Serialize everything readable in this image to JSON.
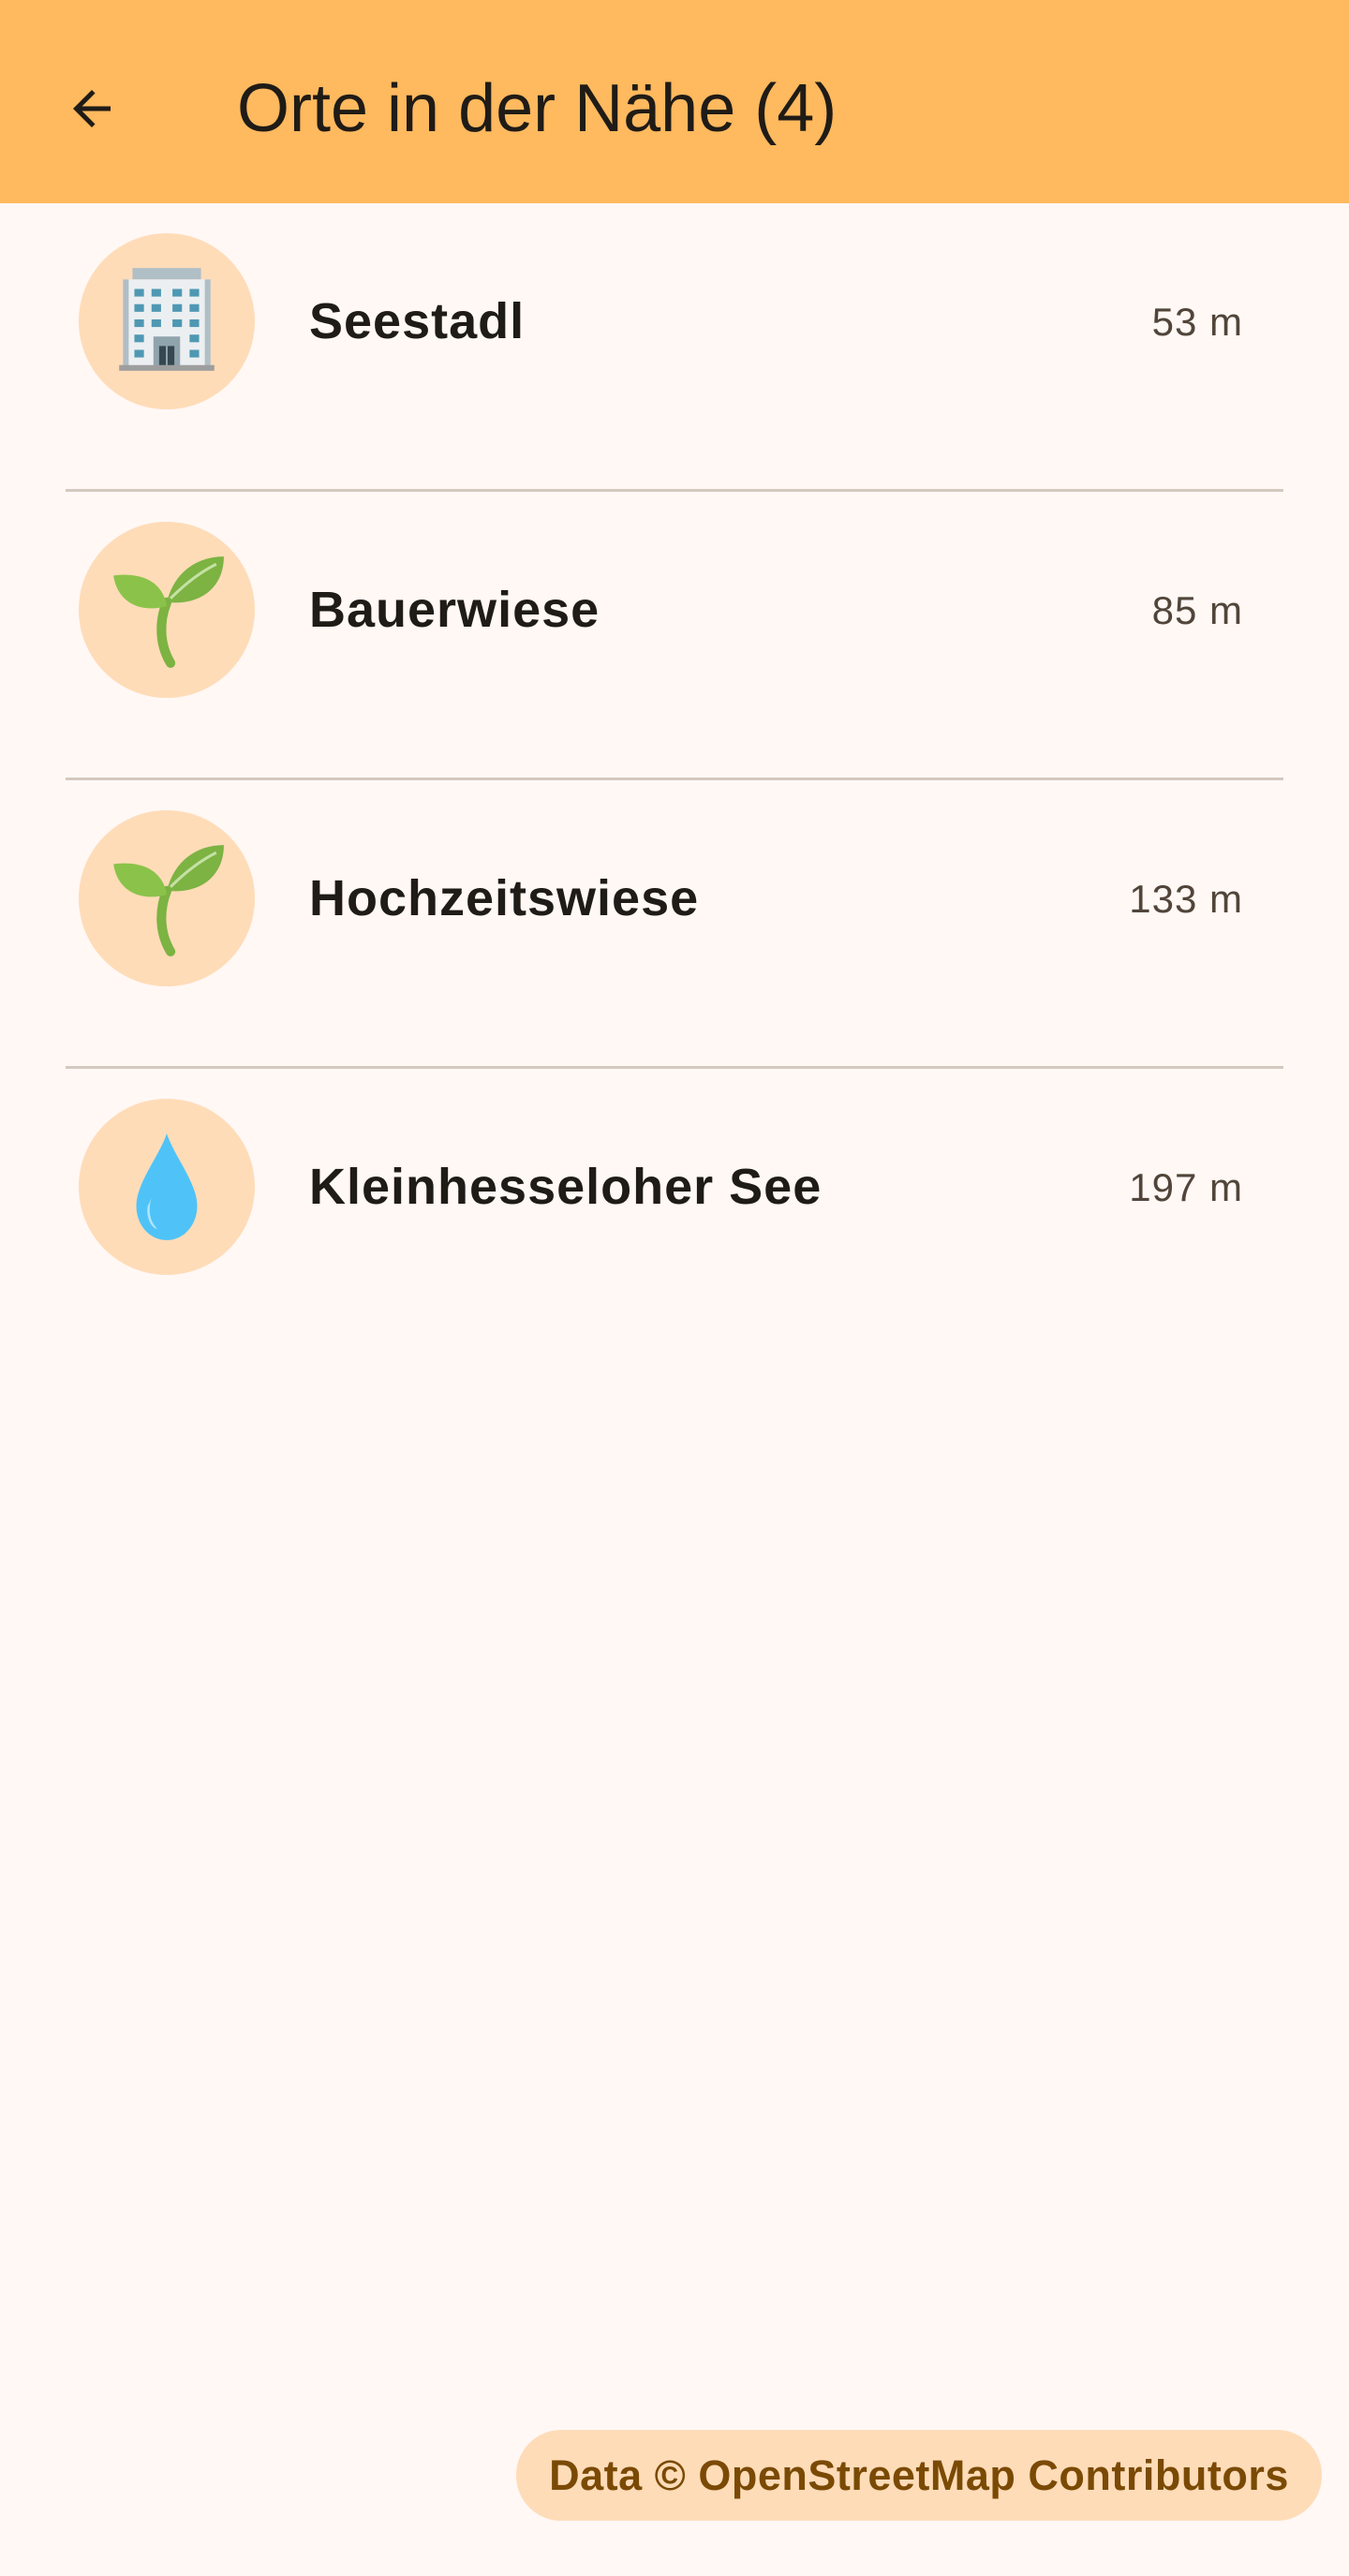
{
  "app_bar": {
    "title": "Orte in der Nähe (4)",
    "back_icon": "arrow-back-icon"
  },
  "places": [
    {
      "name": "Seestadl",
      "distance": "53 m",
      "icon": "building-icon"
    },
    {
      "name": "Bauerwiese",
      "distance": "85 m",
      "icon": "seedling-icon"
    },
    {
      "name": "Hochzeitswiese",
      "distance": "133 m",
      "icon": "seedling-icon"
    },
    {
      "name": "Kleinhesseloher See",
      "distance": "197 m",
      "icon": "droplet-icon"
    }
  ],
  "attribution": {
    "text": "Data © OpenStreetMap Contributors"
  },
  "colors": {
    "app_bar": "#ffb95e",
    "background": "#fff8f5",
    "avatar_bg": "#ffdcb8",
    "attribution_text": "#7a4a05"
  }
}
